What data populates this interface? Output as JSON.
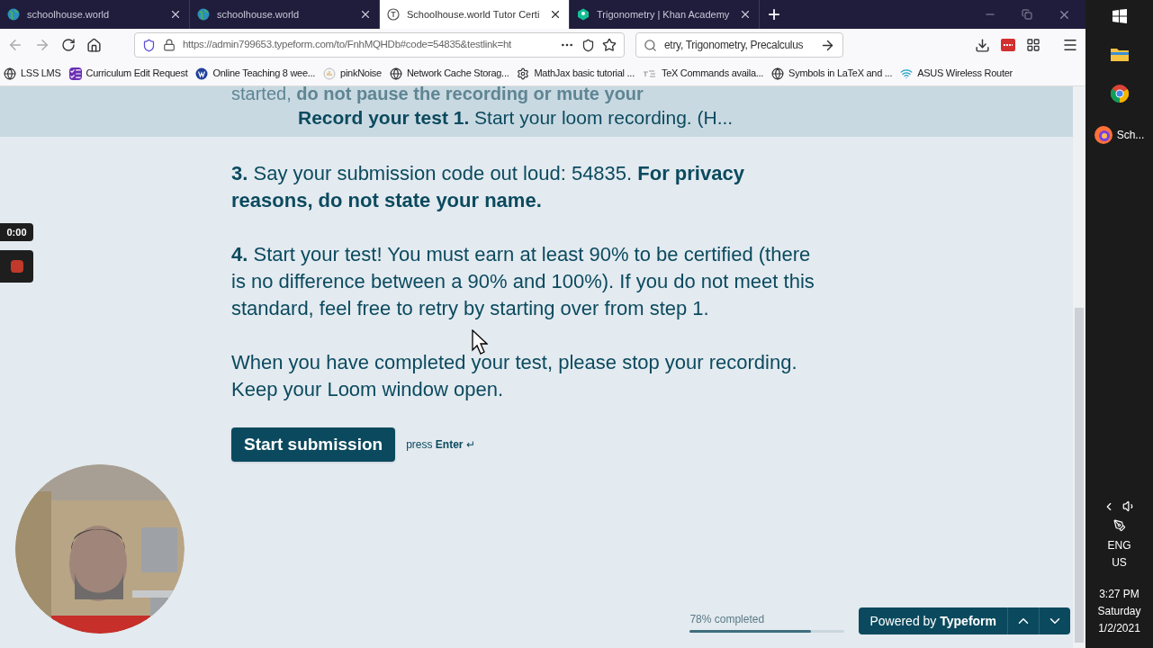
{
  "browser": {
    "tabs": [
      {
        "title": "schoolhouse.world",
        "kind": "globe",
        "selected": false
      },
      {
        "title": "schoolhouse.world",
        "kind": "globe",
        "selected": false
      },
      {
        "title": "Schoolhouse.world Tutor Certi",
        "kind": "letter",
        "selected": true
      },
      {
        "title": "Trigonometry | Khan Academy",
        "kind": "khan",
        "selected": false
      }
    ],
    "new_tab": "+",
    "url": "https://admin799653.typeform.com/to/FnhMQHDb#code=54835&testlink=ht",
    "search": "etry, Trigonometry, Precalculus",
    "bookmarks": [
      {
        "label": "LSS LMS",
        "kind": "globe"
      },
      {
        "label": "Curriculum Edit Request",
        "kind": "form"
      },
      {
        "label": "Online Teaching 8 wee...",
        "kind": "wp"
      },
      {
        "label": "pinkNoise",
        "kind": "noise"
      },
      {
        "label": "Network Cache Storag...",
        "kind": "globe"
      },
      {
        "label": "MathJax basic tutorial ...",
        "kind": "gear"
      },
      {
        "label": "TeX Commands availa...",
        "kind": "tex"
      },
      {
        "label": "Symbols in LaTeX and ...",
        "kind": "globe"
      },
      {
        "label": "ASUS Wireless Router",
        "kind": "wifi"
      }
    ]
  },
  "form": {
    "behind_text": "started, **do not pause the recording or mute your**",
    "header": "**Record your test 1.** Start your loom recording. (H...",
    "paragraphs": [
      "**3.** Say your submission code out loud: 54835. **For privacy reasons, do not state your name.**",
      "**4.** Start your test! You must earn at least 90% to be certified (there is no difference between a 90% and 100%). If you do not meet this standard, feel free to retry by starting over from step 1.",
      "When you have completed your test, please stop your recording. Keep your Loom window open."
    ],
    "submit_button": "Start submission",
    "hint": "press **Enter** ↵",
    "progress": {
      "label": "78% completed",
      "level": 0.78
    },
    "powered_by": "Powered by **Typeform**"
  },
  "loom": {
    "timer": "0:00"
  },
  "taskbar": {
    "apps": [
      {
        "kind": "windows"
      },
      {
        "kind": "explorer"
      },
      {
        "kind": "chrome"
      },
      {
        "kind": "firefox",
        "label": "Sch..."
      }
    ],
    "language": "ENG",
    "region": "US",
    "time": "3:27 PM",
    "day": "Saturday",
    "date": "1/2/2021"
  }
}
